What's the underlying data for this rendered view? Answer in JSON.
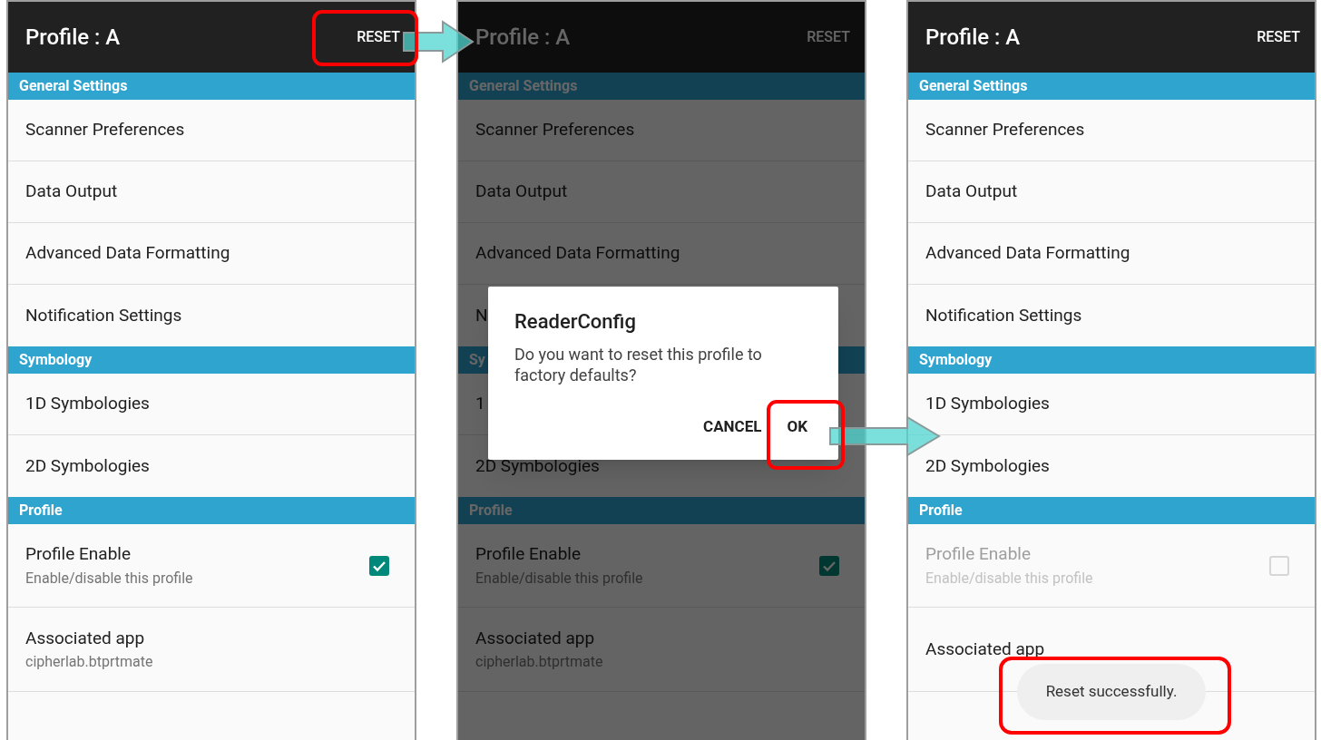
{
  "screens": [
    {
      "title": "Profile : A",
      "action": "RESET",
      "dimmed": false,
      "sections": [
        {
          "header": "General Settings",
          "items": [
            {
              "kind": "link",
              "title": "Scanner Preferences"
            },
            {
              "kind": "link",
              "title": "Data Output"
            },
            {
              "kind": "link",
              "title": "Advanced Data Formatting"
            },
            {
              "kind": "link",
              "title": "Notification Settings"
            }
          ]
        },
        {
          "header": "Symbology",
          "items": [
            {
              "kind": "link",
              "title": "1D Symbologies"
            },
            {
              "kind": "link",
              "title": "2D Symbologies"
            }
          ]
        },
        {
          "header": "Profile",
          "items": [
            {
              "kind": "checkbox",
              "title": "Profile Enable",
              "subtitle": "Enable/disable this profile",
              "checked": true,
              "disabled": false
            },
            {
              "kind": "info",
              "title": "Associated app",
              "subtitle": "cipherlab.btprtmate"
            }
          ]
        }
      ]
    },
    {
      "title": "Profile : A",
      "action": "RESET",
      "dimmed": true,
      "sections": [
        {
          "header": "General Settings",
          "items": [
            {
              "kind": "link",
              "title": "Scanner Preferences"
            },
            {
              "kind": "link",
              "title": "Data Output"
            },
            {
              "kind": "link",
              "title": "Advanced Data Formatting"
            },
            {
              "kind": "link",
              "title": "N"
            }
          ]
        },
        {
          "header": "Sy",
          "items": [
            {
              "kind": "link",
              "title": "1"
            },
            {
              "kind": "link",
              "title": "2D Symbologies"
            }
          ]
        },
        {
          "header": "Profile",
          "items": [
            {
              "kind": "checkbox",
              "title": "Profile Enable",
              "subtitle": "Enable/disable this profile",
              "checked": true,
              "disabled": false
            },
            {
              "kind": "info",
              "title": "Associated app",
              "subtitle": "cipherlab.btprtmate"
            }
          ]
        }
      ],
      "dialog": {
        "title": "ReaderConfig",
        "message": "Do you want to reset this profile to factory defaults?",
        "buttons": [
          "CANCEL",
          "OK"
        ]
      }
    },
    {
      "title": "Profile : A",
      "action": "RESET",
      "dimmed": false,
      "sections": [
        {
          "header": "General Settings",
          "items": [
            {
              "kind": "link",
              "title": "Scanner Preferences"
            },
            {
              "kind": "link",
              "title": "Data Output"
            },
            {
              "kind": "link",
              "title": "Advanced Data Formatting"
            },
            {
              "kind": "link",
              "title": "Notification Settings"
            }
          ]
        },
        {
          "header": "Symbology",
          "items": [
            {
              "kind": "link",
              "title": "1D Symbologies"
            },
            {
              "kind": "link",
              "title": "2D Symbologies"
            }
          ]
        },
        {
          "header": "Profile",
          "items": [
            {
              "kind": "checkbox",
              "title": "Profile Enable",
              "subtitle": "Enable/disable this profile",
              "checked": false,
              "disabled": true
            },
            {
              "kind": "info",
              "title": "Associated app"
            }
          ]
        }
      ],
      "toast": "Reset successfully."
    }
  ]
}
